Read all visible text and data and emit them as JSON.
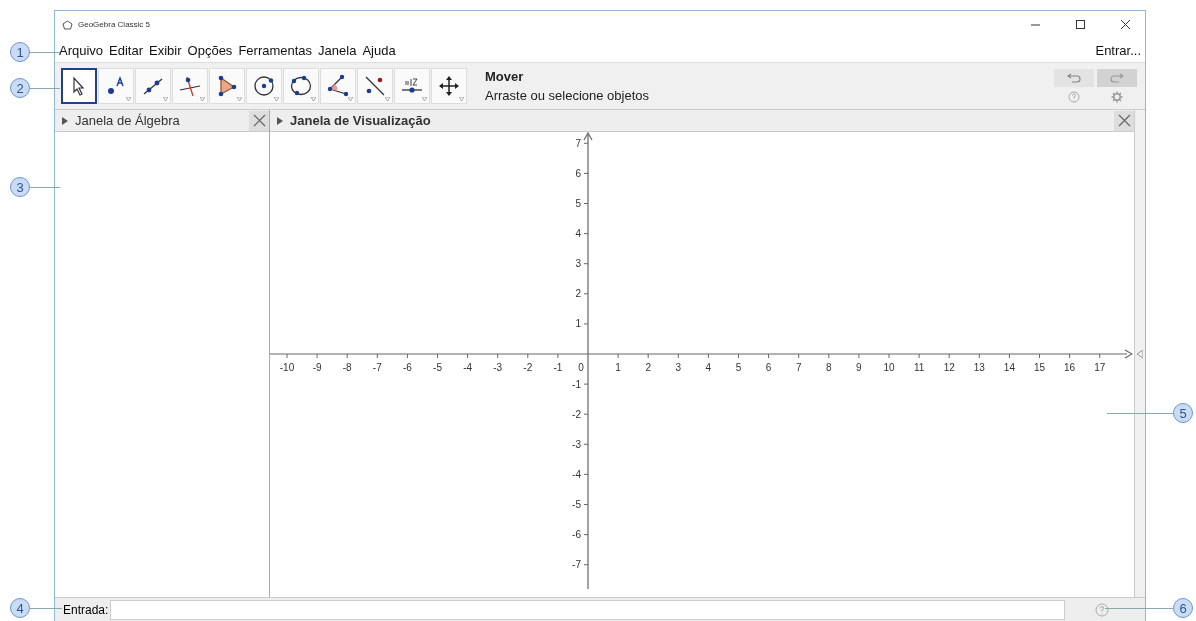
{
  "window": {
    "title": "GeoGebra Classic 5"
  },
  "menu": {
    "items": [
      "Arquivo",
      "Editar",
      "Exibir",
      "Opções",
      "Ferramentas",
      "Janela",
      "Ajuda"
    ],
    "sign_in": "Entrar..."
  },
  "toolbar": {
    "tools": [
      {
        "kind": "move",
        "selected": true
      },
      {
        "kind": "point",
        "selected": false
      },
      {
        "kind": "line",
        "selected": false
      },
      {
        "kind": "perpendicular",
        "selected": false
      },
      {
        "kind": "polygon",
        "selected": false
      },
      {
        "kind": "circle",
        "selected": false
      },
      {
        "kind": "conic",
        "selected": false
      },
      {
        "kind": "angle",
        "selected": false
      },
      {
        "kind": "reflect",
        "selected": false
      },
      {
        "kind": "slider",
        "selected": false
      },
      {
        "kind": "pan",
        "selected": false
      }
    ],
    "mode_name": "Mover",
    "mode_hint": "Arraste ou selecione objetos"
  },
  "algebra_view": {
    "title": "Janela de Álgebra"
  },
  "graphics_view": {
    "title": "Janela de Visualização",
    "x_labels": [
      "-10",
      "-9",
      "-8",
      "-7",
      "-6",
      "-5",
      "-4",
      "-3",
      "-2",
      "-1",
      "0",
      "1",
      "2",
      "3",
      "4",
      "5",
      "6",
      "7",
      "8",
      "9",
      "10",
      "11",
      "12",
      "13",
      "14",
      "15",
      "16",
      "17"
    ],
    "y_labels": [
      "7",
      "6",
      "5",
      "4",
      "3",
      "2",
      "1",
      "-1",
      "-2",
      "-3",
      "-4",
      "-5",
      "-6",
      "-7"
    ]
  },
  "input_bar": {
    "label": "Entrada:"
  },
  "callouts": [
    {
      "label": "1"
    },
    {
      "label": "2"
    },
    {
      "label": "3"
    },
    {
      "label": "4"
    },
    {
      "label": "5"
    },
    {
      "label": "6"
    }
  ]
}
